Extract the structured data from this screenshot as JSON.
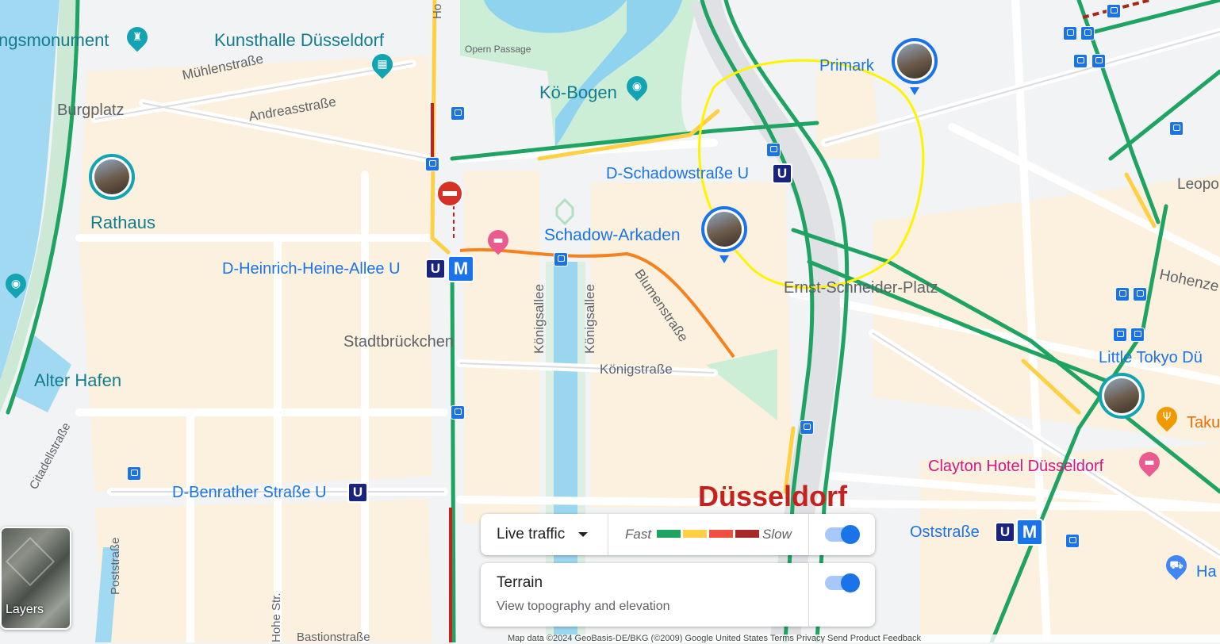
{
  "map": {
    "city_label": "Düsseldorf",
    "poi": {
      "kunsthalle": "Kunsthalle Düsseldorf",
      "ko_bogen": "Kö-Bogen",
      "schadow_arkaden": "Schadow-Arkaden",
      "primark": "Primark",
      "rathaus": "Rathaus",
      "monument": "ngsmonument",
      "clayton": "Clayton Hotel Düsseldorf",
      "little_tokyo": "Little Tokyo Dü",
      "taku": "Taku",
      "ha": "Ha"
    },
    "places": {
      "burgplatz": "Burgplatz",
      "stadtbrueckchen": "Stadtbrückchen",
      "ernst_schneider": "Ernst-Schneider-Platz",
      "alter_hafen": "Alter Hafen"
    },
    "stations": {
      "heinrich_heine": "D-Heinrich-Heine-Allee U",
      "schadowstrasse": "D-Schadowstraße U",
      "benrather": "D-Benrather Straße U",
      "oststrasse": "Oststraße",
      "u_letter": "U",
      "m_letter": "M"
    },
    "streets": {
      "muehlenstrasse": "Mühlenstraße",
      "andreasstrasse": "Andreasstraße",
      "opern_passage": "Opern Passage",
      "koenigsallee_1": "Königsallee",
      "koenigsallee_2": "Königsallee",
      "blumenstrasse": "Blumenstraße",
      "koenigstrasse": "Königstraße",
      "citadellstrasse": "Citadellstraße",
      "poststrasse": "Poststraße",
      "hohe_str": "Hohe Str.",
      "bastionstrasse": "Bastionstraße",
      "leopo": "Leopo",
      "hohenze": "Hohenze",
      "ho": "Ho"
    }
  },
  "layers_button": {
    "label": "Layers"
  },
  "traffic_card": {
    "dropdown_label": "Live traffic",
    "legend_fast": "Fast",
    "legend_slow": "Slow",
    "legend_colors": [
      "#1ea362",
      "#ffcf44",
      "#f24e42",
      "#a92727"
    ],
    "toggle_on": true
  },
  "terrain_card": {
    "title": "Terrain",
    "subtitle": "View topography and elevation",
    "toggle_on": true
  },
  "attribution": "Map data ©2024 GeoBasis-DE/BKG (©2009) Google United States Terms Privacy Send Product Feedback"
}
